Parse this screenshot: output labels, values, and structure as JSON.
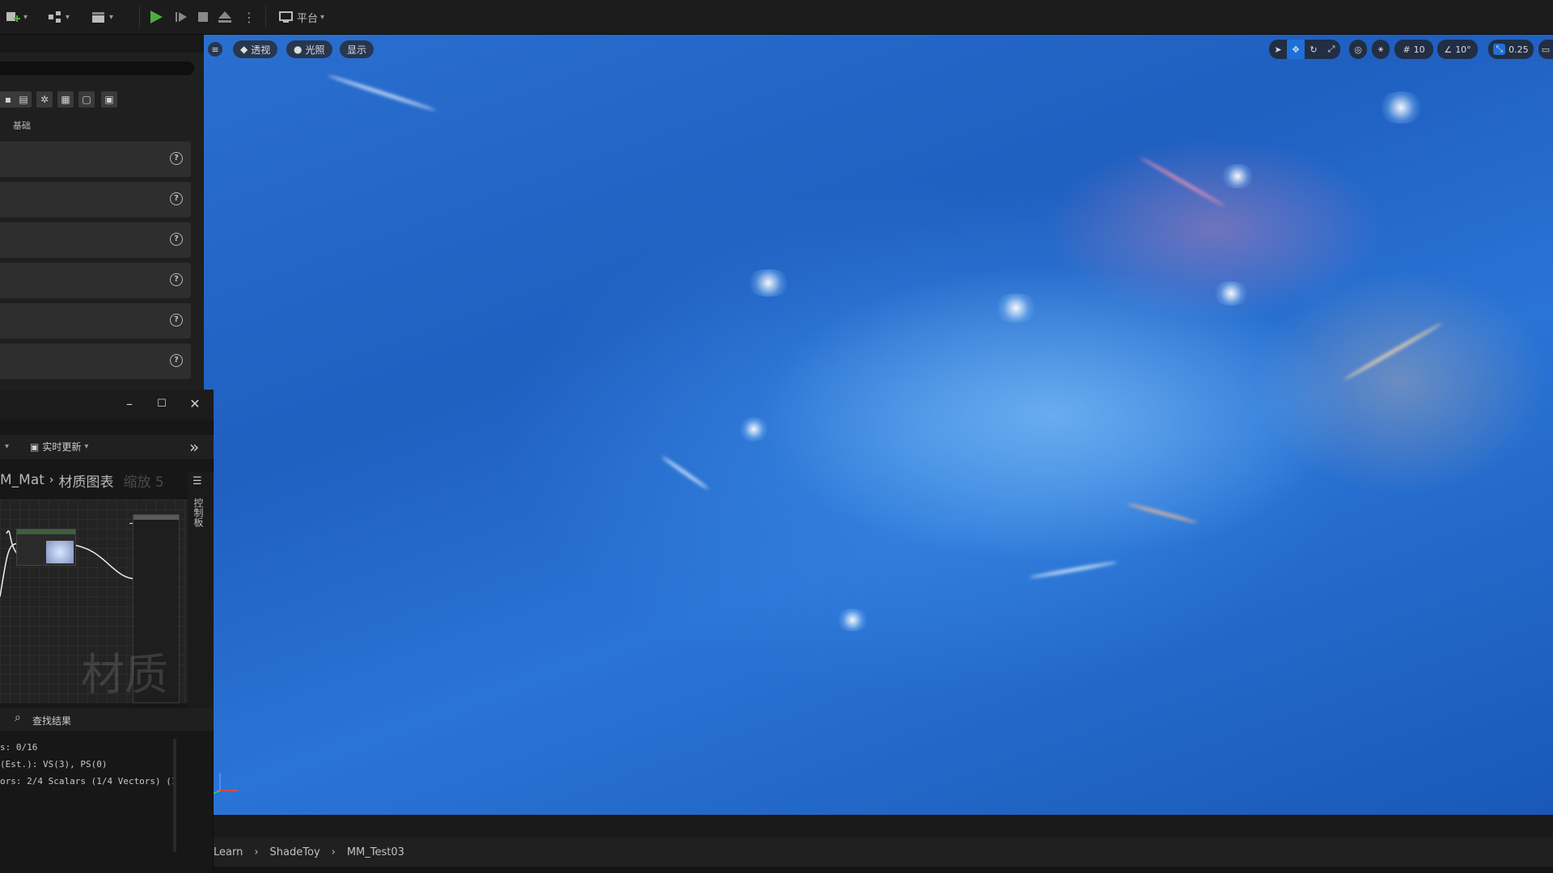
{
  "toolbar": {
    "platform_label": "平台"
  },
  "details": {
    "category_basic": "基础",
    "rows": [
      {
        "help": "?"
      },
      {
        "help": "?"
      },
      {
        "help": "?"
      },
      {
        "help": "?"
      },
      {
        "help": "?"
      },
      {
        "help": "?"
      }
    ]
  },
  "material_editor": {
    "window_controls": {
      "minimize": "–",
      "maximize": "☐",
      "close": "✕"
    },
    "live_update_label": "实时更新",
    "breadcrumb": {
      "asset": "M_Mat",
      "graph": "材质图表",
      "zoom": "缩放 5"
    },
    "palette_label": "控制板",
    "graph_watermark": "材质",
    "find_results_label": "查找结果",
    "stats": [
      "s: 0/16",
      "(Est.): VS(3), PS(0)",
      "ors: 2/4 Scalars (1/4 Vectors) (1"
    ]
  },
  "viewport": {
    "perspective_label": "透视",
    "lighting_label": "光照",
    "show_label": "显示",
    "grid_snap_value": "10",
    "rotation_snap_value": "10°",
    "scale_snap_value": "0.25"
  },
  "content_path": {
    "items": [
      "Learn",
      "ShadeToy",
      "MM_Test03"
    ]
  },
  "colors": {
    "accent_play": "#4cae3c",
    "accent_selected": "#1f6fd6",
    "panel_bg": "#1f1f1f"
  }
}
